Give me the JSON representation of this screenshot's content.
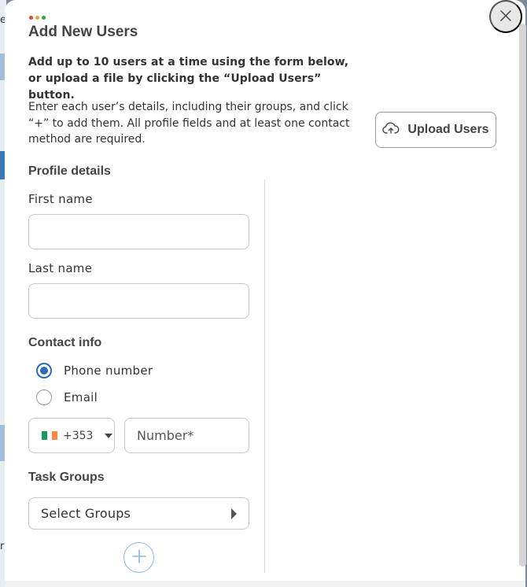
{
  "window": {
    "dots": [
      "#e0443e",
      "#e6a52e",
      "#2ea043"
    ]
  },
  "background": {
    "glyphs": [
      "e",
      "r"
    ]
  },
  "modal": {
    "title": "Add New Users",
    "close_icon": "close-icon",
    "intro_bold": "Add up to 10 users at a time using the form below, or upload a file by clicking the “Upload Users” button.",
    "intro_text": "Enter each user’s details, including their groups, and click “+” to add them. All profile fields and at least one contact method are required.",
    "upload_button": {
      "label": "Upload Users",
      "icon": "cloud-upload-icon"
    }
  },
  "profile": {
    "section_title": "Profile details",
    "first_name_label": "First name",
    "first_name_value": "",
    "last_name_label": "Last name",
    "last_name_value": ""
  },
  "contact": {
    "section_title": "Contact info",
    "options": [
      {
        "label": "Phone number",
        "checked": true
      },
      {
        "label": "Email",
        "checked": false
      }
    ],
    "country": {
      "flag": "ireland-flag-icon",
      "flag_colors": [
        "#169b62",
        "#ffffff",
        "#ff883e"
      ],
      "dial_code": "+353"
    },
    "number_placeholder": "Number*",
    "number_value": ""
  },
  "task_groups": {
    "section_title": "Task Groups",
    "select_label": "Select Groups"
  },
  "add_button": {
    "icon": "plus-icon",
    "color": "#8fb6de"
  },
  "colors": {
    "accent": "#2d6bb2"
  }
}
